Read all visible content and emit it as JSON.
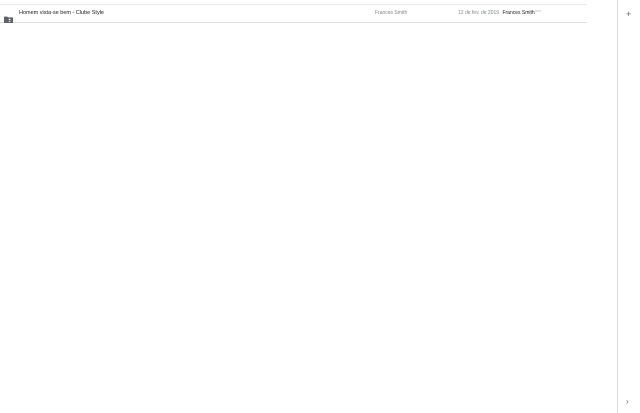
{
  "file_list": {
    "rows": [
      {
        "icon": "shared-folder-icon",
        "name": "Homem vista-se bem - Clube Style",
        "owner": "Frances Smith",
        "modified_date": "12 de fev. de 2019",
        "modified_by": "Frances Smith"
      }
    ]
  },
  "side_panel": {
    "add_icon": "plus-icon",
    "expand_icon": "chevron-right-icon"
  },
  "colors": {
    "text_primary": "#202124",
    "text_secondary": "#80868b",
    "divider": "#e0e0e0",
    "icon": "#5f6368"
  }
}
